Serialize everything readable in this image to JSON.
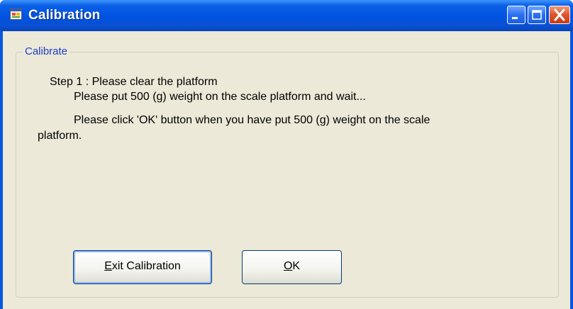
{
  "window": {
    "title": "Calibration",
    "icons": {
      "app": "app-window-icon",
      "minimize": "minimize-icon",
      "maximize": "maximize-icon",
      "close": "close-icon"
    }
  },
  "group": {
    "title": "Calibrate"
  },
  "messages": {
    "step": "Step 1 : Please clear the platform",
    "line1": "Please put 500 (g) weight on the scale platform and wait...",
    "line2": "Please click 'OK' button when you have put 500 (g) weight on the scale",
    "line3": "platform."
  },
  "buttons": {
    "exit": {
      "mnemonic": "E",
      "rest": "xit Calibration"
    },
    "ok": {
      "mnemonic": "O",
      "rest": "K"
    }
  },
  "colors": {
    "titlebar": "#0053e1",
    "window_face": "#ece9d8",
    "group_title": "#1e3ec8",
    "close_button": "#e2532a"
  }
}
